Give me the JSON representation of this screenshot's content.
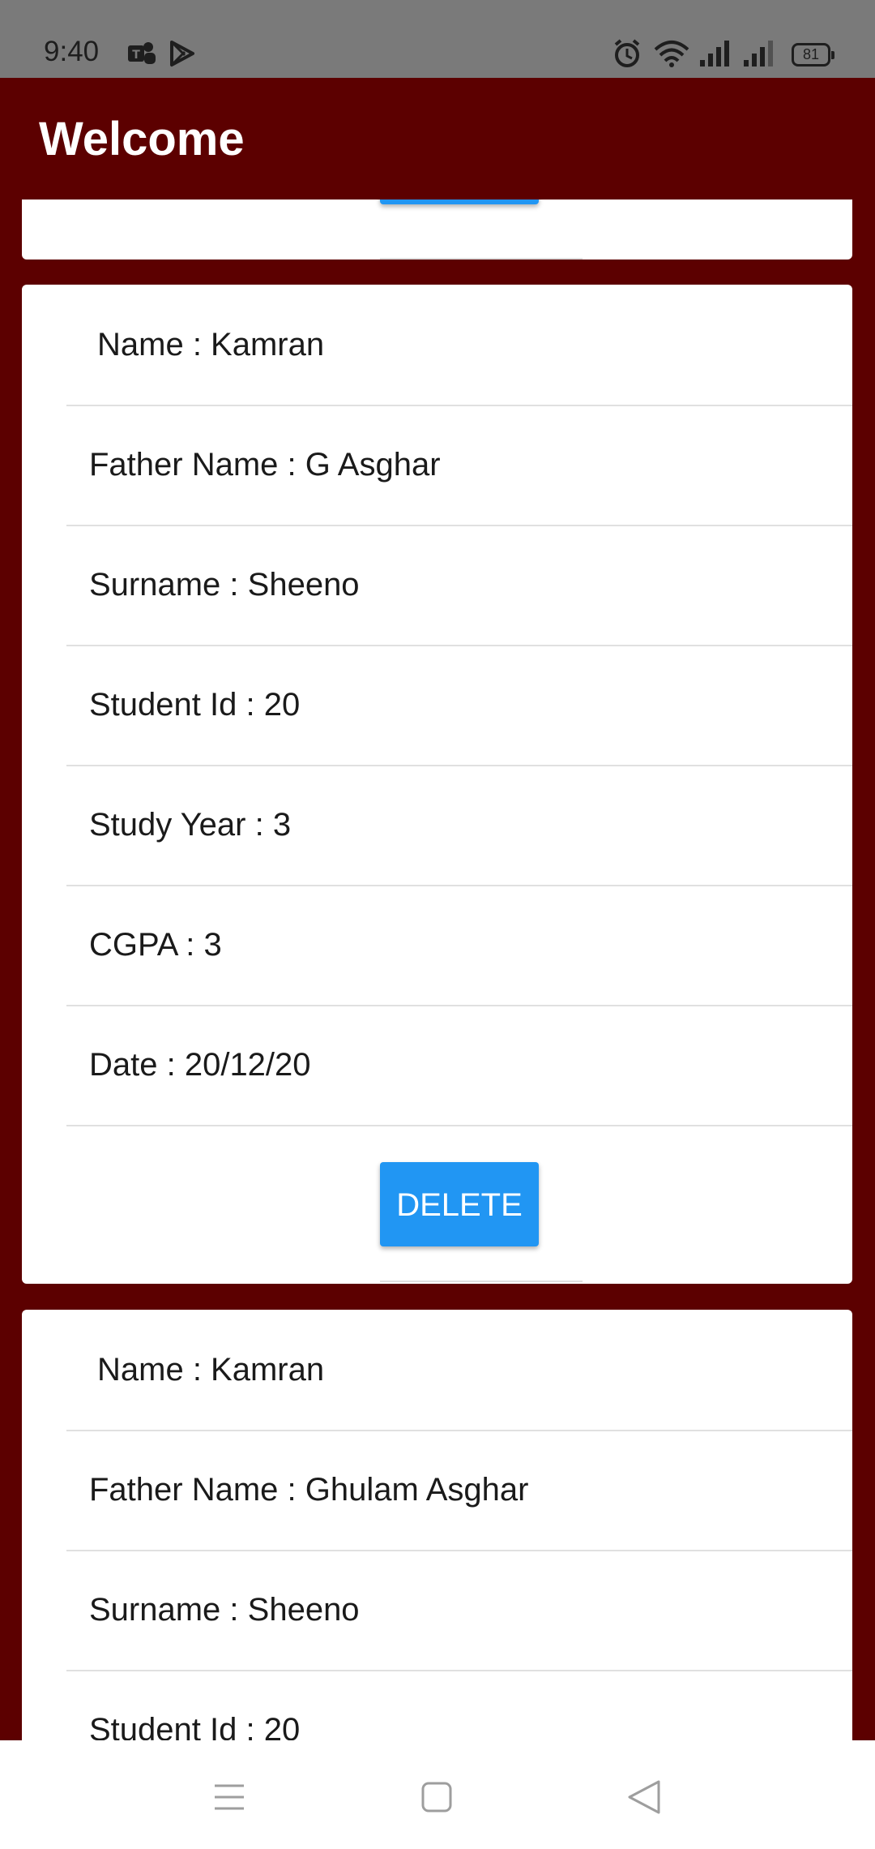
{
  "status_bar": {
    "time": "9:40",
    "battery": "81",
    "icons": [
      "teams-icon",
      "play-store-icon",
      "alarm-icon",
      "wifi-icon",
      "signal-icon",
      "signal-icon",
      "battery-icon"
    ]
  },
  "app_bar": {
    "title": "Welcome"
  },
  "cards": [
    {
      "name": "Name : Kamran",
      "father_name": "Father Name : G Asghar",
      "surname": "Surname : Sheeno",
      "student_id": "Student Id : 20",
      "study_year": "Study Year : 3",
      "cgpa": "CGPA : 3",
      "date": "Date : 20/12/20",
      "delete_label": "DELETE"
    },
    {
      "name": "Name : Kamran",
      "father_name": "Father Name : Ghulam Asghar",
      "surname": "Surname : Sheeno",
      "student_id": "Student Id : 20"
    }
  ],
  "colors": {
    "background": "#5c0000",
    "status_bar": "#7a7a7a",
    "button": "#2196f3",
    "card": "#ffffff"
  },
  "nav_bar": {
    "icons": [
      "menu-icon",
      "home-icon",
      "back-icon"
    ]
  }
}
